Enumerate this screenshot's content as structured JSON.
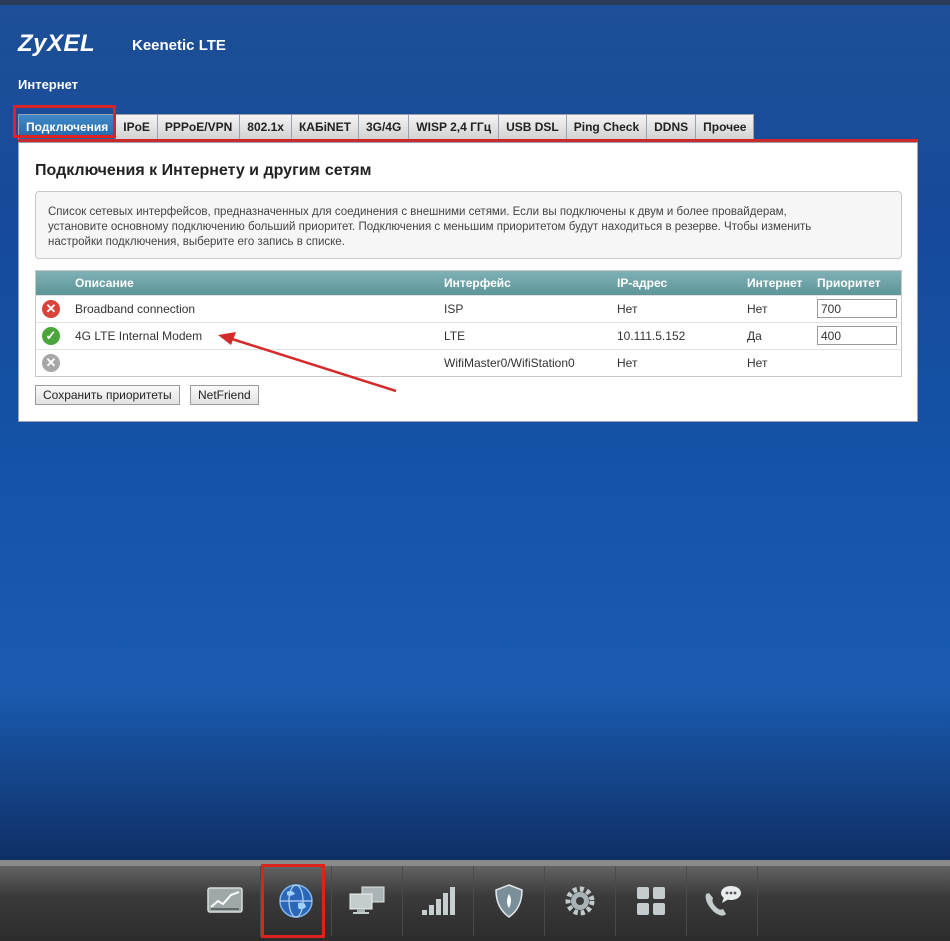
{
  "brand": {
    "logo": "ZyXEL",
    "model": "Keenetic LTE"
  },
  "section": "Интернет",
  "tabs": [
    "Подключения",
    "IPoE",
    "PPPoE/VPN",
    "802.1x",
    "КАБiNET",
    "3G/4G",
    "WISP 2,4 ГГц",
    "USB DSL",
    "Ping Check",
    "DDNS",
    "Прочее"
  ],
  "active_tab": "Подключения",
  "panel": {
    "title": "Подключения к Интернету и другим сетям",
    "info_line1": "Список сетевых интерфейсов, предназначенных для соединения с внешними сетями. Если вы подключены к двум и более провайдерам,",
    "info_line2": "установите основному подключению больший приоритет. Подключения с меньшим приоритетом будут находиться в резерве. Чтобы изменить",
    "info_line3": "настройки подключения, выберите его запись в списке."
  },
  "table": {
    "headers": {
      "description": "Описание",
      "interface": "Интерфейс",
      "ip": "IP-адрес",
      "internet": "Интернет",
      "priority": "Приоритет"
    },
    "rows": [
      {
        "status": "error",
        "status_icon": "✕",
        "description": "Broadband connection",
        "interface": "ISP",
        "ip": "Нет",
        "internet": "Нет",
        "priority": "700"
      },
      {
        "status": "ok",
        "status_icon": "✓",
        "description": "4G LTE Internal Modem",
        "interface": "LTE",
        "ip": "10.111.5.152",
        "internet": "Да",
        "priority": "400"
      },
      {
        "status": "disabled",
        "status_icon": "✕",
        "description": "",
        "interface": "WifiMaster0/WifiStation0",
        "ip": "Нет",
        "internet": "Нет",
        "priority": ""
      }
    ]
  },
  "buttons": {
    "save_priorities": "Сохранить приоритеты",
    "netfriend": "NetFriend"
  },
  "nav_icons": [
    "monitor-chart-icon",
    "globe-icon",
    "computers-icon",
    "signal-bars-icon",
    "shield-icon",
    "gear-icon",
    "apps-grid-icon",
    "phone-chat-icon"
  ],
  "colors": {
    "accent_red": "#cc2a2a",
    "active_tab": "#2f78bb",
    "table_header": "#6fa3a7",
    "ok": "#4aa63a",
    "error": "#d8443c"
  }
}
